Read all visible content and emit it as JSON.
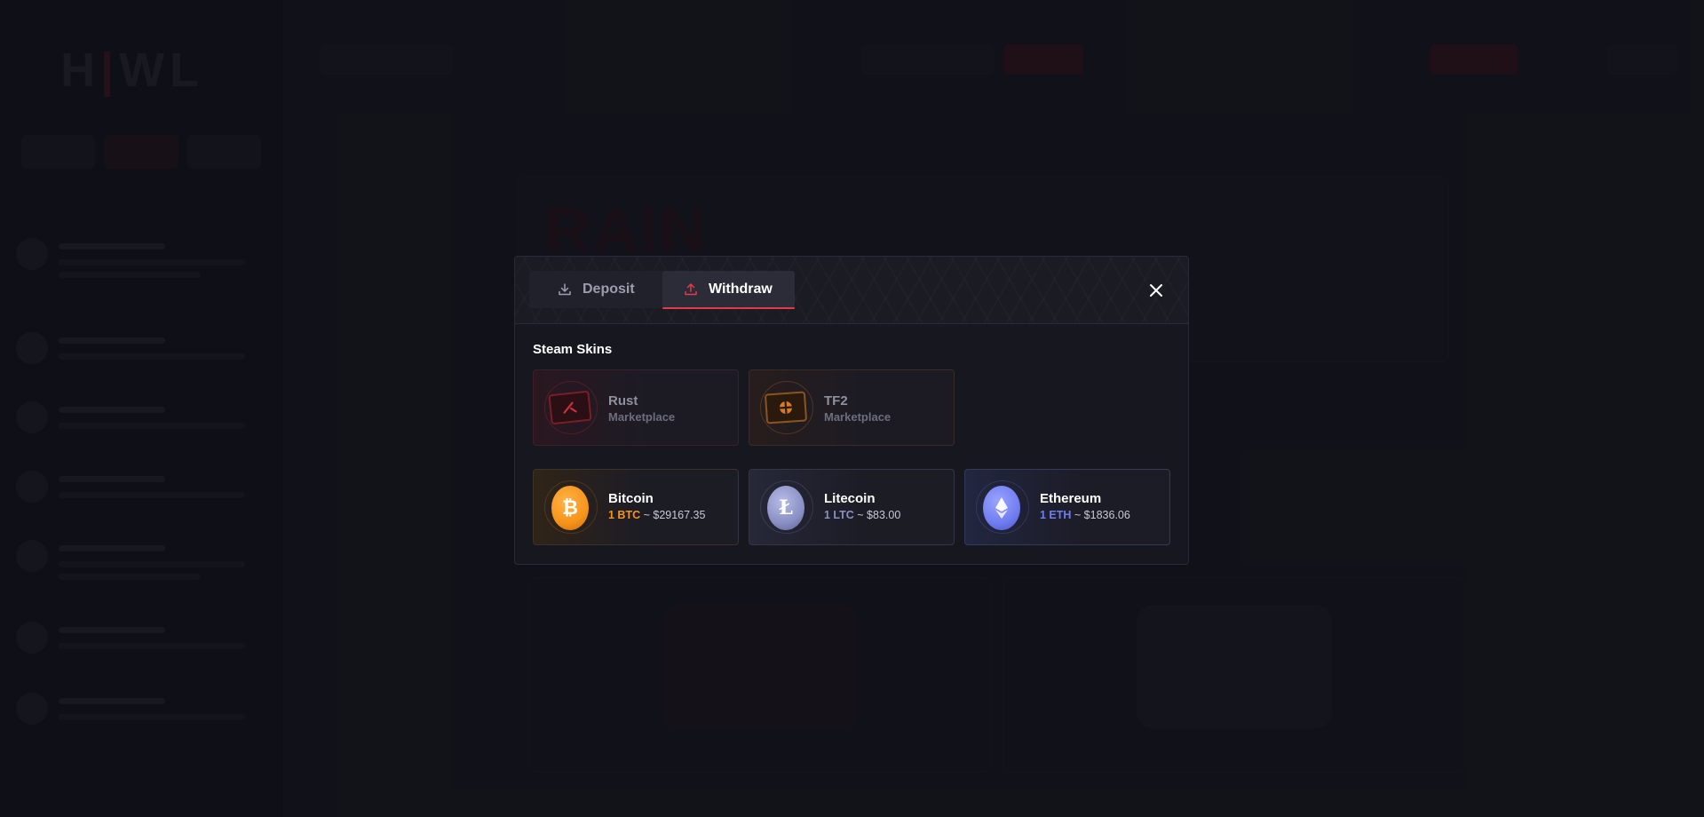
{
  "modal": {
    "tabs": [
      {
        "label": "Deposit",
        "icon": "download-icon",
        "active": false
      },
      {
        "label": "Withdraw",
        "icon": "upload-icon",
        "active": true
      }
    ],
    "section_title": "Steam Skins",
    "skins": [
      {
        "name": "Rust",
        "sub": "Marketplace",
        "icon": "rust-marketplace-icon",
        "accent": "#c8303c"
      },
      {
        "name": "TF2",
        "sub": "Marketplace",
        "icon": "tf2-marketplace-icon",
        "accent": "#d67a2a"
      }
    ],
    "crypto": [
      {
        "name": "Bitcoin",
        "unit": "1 BTC",
        "rate": " ~ $29167.35",
        "icon": "bitcoin-icon",
        "color": "#f7931a"
      },
      {
        "name": "Litecoin",
        "unit": "1 LTC",
        "rate": " ~ $83.00",
        "icon": "litecoin-icon",
        "color": "#8a8fc4"
      },
      {
        "name": "Ethereum",
        "unit": "1 ETH",
        "rate": " ~ $1836.06",
        "icon": "ethereum-icon",
        "color": "#6f7df0"
      }
    ],
    "close_icon": "close-icon"
  },
  "colors": {
    "accent_red": "#e23a4a",
    "background": "#15151d"
  }
}
